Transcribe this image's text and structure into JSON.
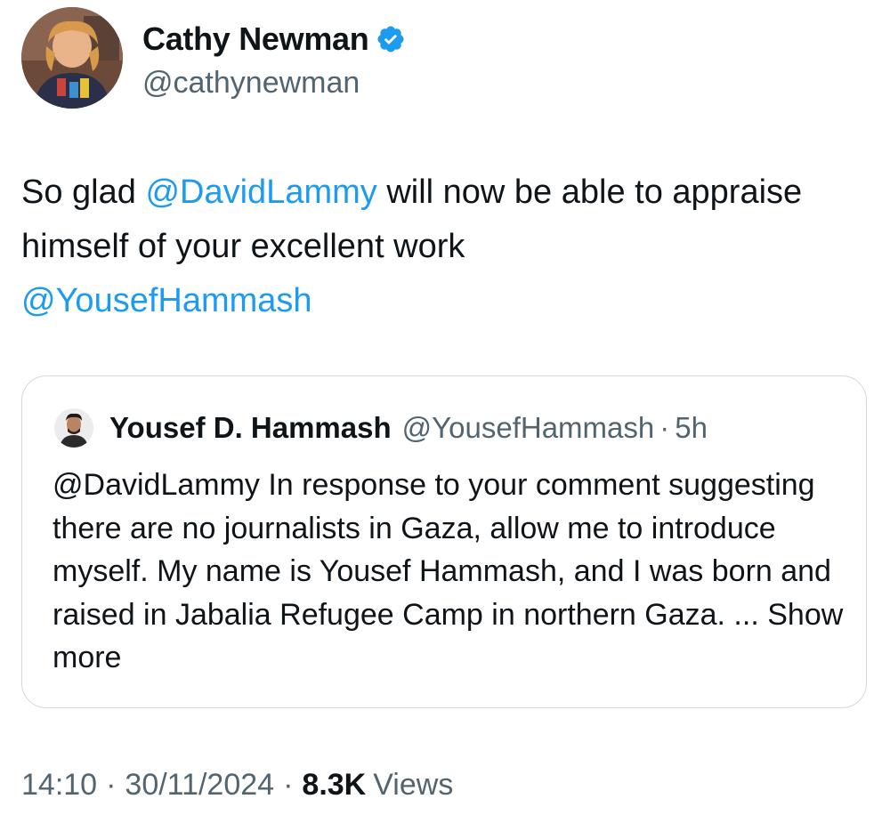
{
  "author": {
    "name": "Cathy Newman",
    "handle": "@cathynewman",
    "verified_color": "#1d9bf0"
  },
  "tweet": {
    "text_parts": {
      "p1": "So glad ",
      "mention1": "@DavidLammy",
      "p2": " will now be able to appraise himself of your excellent work ",
      "mention2": "@YousefHammash"
    },
    "time": "14:10",
    "separator": "·",
    "date": "30/11/2024",
    "views_count": "8.3K",
    "views_label": "Views"
  },
  "quoted": {
    "name": "Yousef D. Hammash",
    "handle": "@YousefHammash",
    "separator": "·",
    "time_ago": "5h",
    "text": "@DavidLammy In response to your comment suggesting there are no journalists in Gaza, allow me to introduce myself. My name is Yousef Hammash, and I was born and raised in Jabalia Refugee Camp in northern Gaza. ...",
    "show_more": "Show more"
  },
  "colors": {
    "link": "#1d9bf0",
    "secondary_text": "#536471",
    "primary_text": "#0f1419",
    "border": "#cfd9de"
  }
}
